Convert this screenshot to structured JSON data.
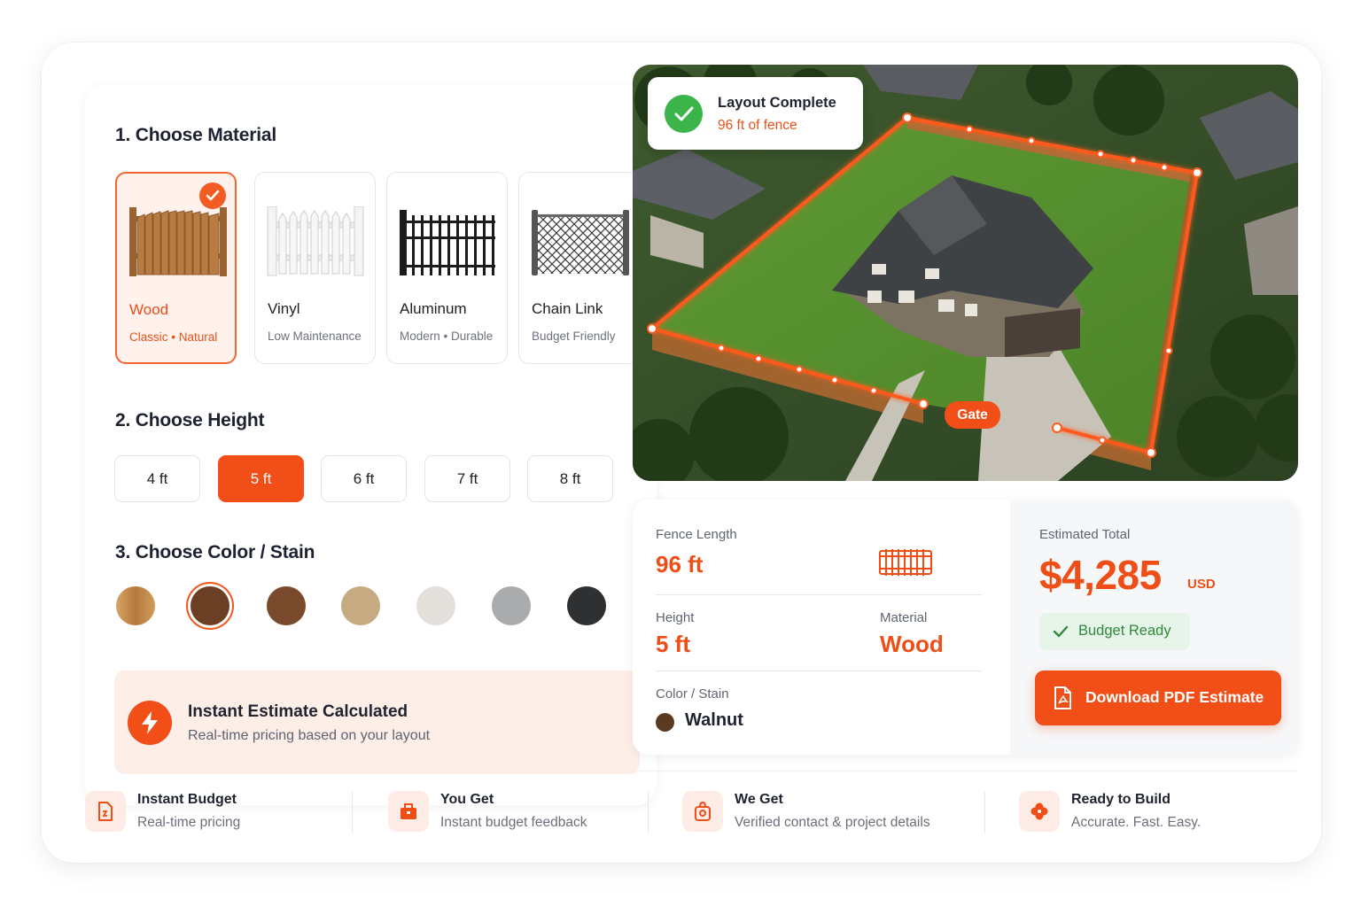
{
  "sections": {
    "material_title": "1. Choose Material",
    "height_title": "2. Choose Height",
    "color_title": "3. Choose Color / Stain"
  },
  "materials": [
    {
      "name": "Wood",
      "sub": "Classic • Natural",
      "selected": true
    },
    {
      "name": "Vinyl",
      "sub": "Low Maintenance",
      "selected": false
    },
    {
      "name": "Aluminum",
      "sub": "Modern • Durable",
      "selected": false
    },
    {
      "name": "Chain Link",
      "sub": "Budget Friendly",
      "selected": false
    }
  ],
  "heights": [
    {
      "label": "4 ft",
      "selected": false
    },
    {
      "label": "5 ft",
      "selected": true
    },
    {
      "label": "6 ft",
      "selected": false
    },
    {
      "label": "7 ft",
      "selected": false
    },
    {
      "label": "8 ft",
      "selected": false
    }
  ],
  "colors": [
    {
      "hex": "#c48a4e",
      "selected": false
    },
    {
      "hex": "#6a3f24",
      "selected": true
    },
    {
      "hex": "#7a4a2c",
      "selected": false
    },
    {
      "hex": "#c7a982",
      "selected": false
    },
    {
      "hex": "#e3e0db",
      "selected": false
    },
    {
      "hex": "#a9abad",
      "selected": false
    },
    {
      "hex": "#2f3032",
      "selected": false
    }
  ],
  "instant": {
    "title": "Instant Estimate Calculated",
    "subtitle": "Real-time pricing based on your layout"
  },
  "map": {
    "status_title": "Layout Complete",
    "status_sub": "96 ft of fence",
    "gate_label": "Gate"
  },
  "summary": {
    "fence_length_label": "Fence Length",
    "fence_length_value": "96 ft",
    "height_label": "Height",
    "height_value": "5 ft",
    "material_label": "Material",
    "material_value": "Wood",
    "color_label": "Color / Stain",
    "color_value": "Walnut",
    "estimated_label": "Estimated Total",
    "total": "$4,285",
    "currency": "USD",
    "budget_status": "Budget Ready",
    "download_label": "Download PDF Estimate"
  },
  "features": [
    {
      "title": "Instant Budget",
      "sub": "Real-time pricing",
      "icon": "document-icon"
    },
    {
      "title": "You Get",
      "sub": "Instant budget feedback",
      "icon": "briefcase-icon"
    },
    {
      "title": "We Get",
      "sub": "Verified contact & project details",
      "icon": "shopping-bag-icon"
    },
    {
      "title": "Ready to Build",
      "sub": "Accurate. Fast. Easy.",
      "icon": "clover-icon"
    }
  ],
  "accent": "#f24e17",
  "success": "#3bb54a"
}
